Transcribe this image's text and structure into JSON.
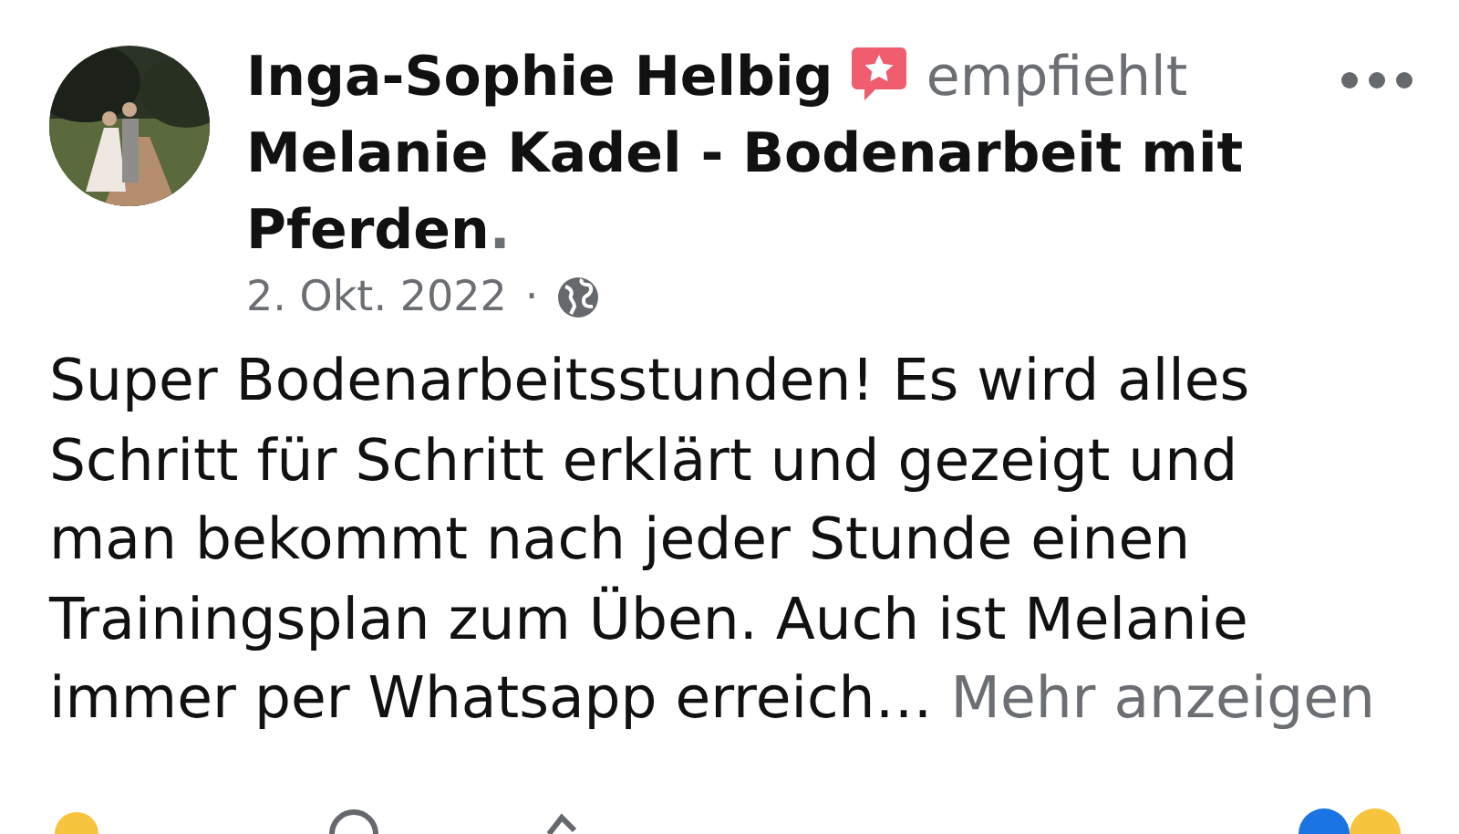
{
  "post": {
    "author": "Inga-Sophie Helbig",
    "verb": "empfiehlt",
    "page": "Melanie Kadel - Bodenarbeit mit Pferden",
    "period": ".",
    "date": "2. Okt. 2022",
    "separator": "·",
    "body_lines": [
      "Super Bodenarbeitsstunden! Es wird alles",
      "Schritt für Schritt erklärt und gezeigt und",
      "man bekommt nach jeder Stunde einen",
      "Trainingsplan zum Üben. Auch ist Melanie",
      "immer per Whatsapp erreich…"
    ],
    "more": "Mehr anzeigen"
  }
}
